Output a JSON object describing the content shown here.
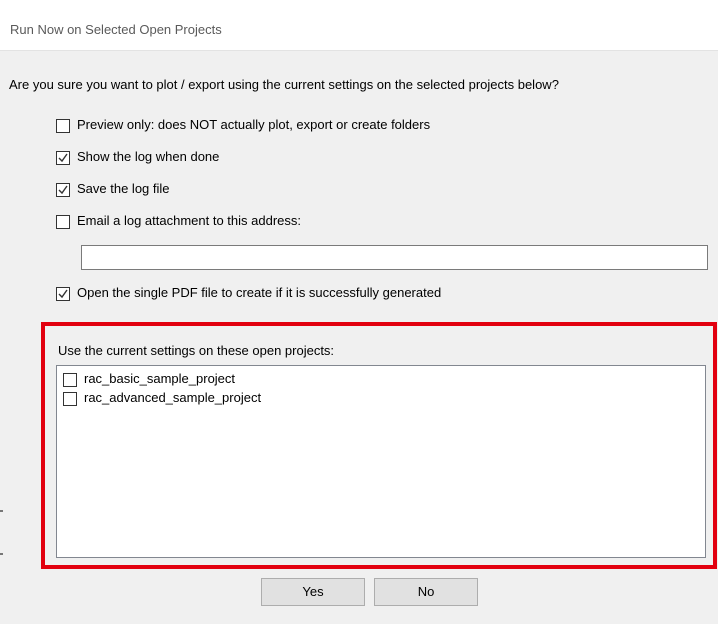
{
  "dialog": {
    "title": "Run Now on Selected Open Projects",
    "question": "Are you sure you want to plot / export using the current settings on the selected projects below?",
    "options": [
      {
        "label": "Preview only:  does NOT actually plot, export or create folders",
        "checked": false
      },
      {
        "label": "Show the log when done",
        "checked": true
      },
      {
        "label": "Save the log file",
        "checked": true
      },
      {
        "label": "Email a log attachment to this address:",
        "checked": false
      }
    ],
    "email_value": "",
    "open_pdf": {
      "label": "Open the single PDF file to create if it is successfully generated",
      "checked": true
    },
    "projects_heading": "Use the current settings on these open projects:",
    "projects": [
      {
        "label": "rac_basic_sample_project",
        "checked": false
      },
      {
        "label": "rac_advanced_sample_project",
        "checked": false
      }
    ],
    "yes_label": "Yes",
    "no_label": "No"
  }
}
